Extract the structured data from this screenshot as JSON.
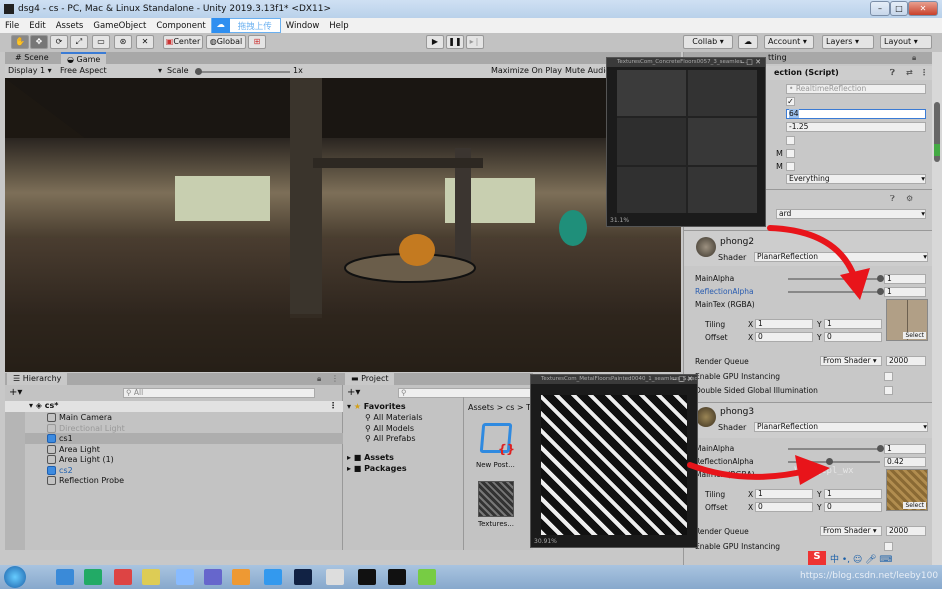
{
  "window": {
    "title": "dsg4 - cs - PC, Mac & Linux Standalone - Unity 2019.3.13f1* <DX11>"
  },
  "menu": [
    "File",
    "Edit",
    "Assets",
    "GameObject",
    "Component",
    "Window",
    "Help"
  ],
  "baidu_overlay": "拖拽上传",
  "toolbar": {
    "center": "Center",
    "global": "Global",
    "collab": "Collab ▾",
    "account": "Account",
    "layers": "Layers",
    "layout": "Layout"
  },
  "tabs": {
    "scene": "Scene",
    "game": "Game"
  },
  "game_toolbar": {
    "display": "Display 1",
    "aspect": "Free Aspect",
    "scale_label": "Scale",
    "scale_value": "1x",
    "maximize": "Maximize On Play",
    "mute": "Mute Audio"
  },
  "inspector": {
    "tab_partial": "tting",
    "component_title": "ection (Script)",
    "script_field": "RealtimeReflection",
    "value_64": "64",
    "value_neg": "-1.25",
    "m1": "M",
    "m2": "M",
    "layer_mask": "Everything",
    "partial_dropdown": "ard",
    "materials": [
      {
        "name": "phong2",
        "shader_label": "Shader",
        "shader": "PlanarReflection",
        "main_alpha_label": "MainAlpha",
        "main_alpha": "1",
        "main_alpha_fraction": 1,
        "refl_alpha_label": "ReflectionAlpha",
        "refl_alpha": "1",
        "refl_alpha_fraction": 1,
        "maintex": "MainTex (RGBA)",
        "tiling": "Tiling",
        "offset": "Offset",
        "tx": "1",
        "ty": "1",
        "ox": "0",
        "oy": "0",
        "select": "Select",
        "render_queue": "Render Queue",
        "rq_mode": "From Shader",
        "rq": "2000",
        "gpu": "Enable GPU Instancing",
        "dsgi": "Double Sided Global Illumination"
      },
      {
        "name": "phong3",
        "shader_label": "Shader",
        "shader": "PlanarReflection",
        "main_alpha_label": "MainAlpha",
        "main_alpha": "1",
        "main_alpha_fraction": 1,
        "refl_alpha_label": "ReflectionAlpha",
        "refl_alpha": "0.42",
        "refl_alpha_fraction": 0.42,
        "maintex": "MainTex (RGBA)",
        "tiling": "Tiling",
        "offset": "Offset",
        "tx": "1",
        "ty": "1",
        "ox": "0",
        "oy": "0",
        "select": "Select",
        "render_queue": "Render Queue",
        "rq_mode": "From Shader",
        "rq": "2000",
        "gpu": "Enable GPU Instancing"
      }
    ],
    "watermark": "VX: qtpl_wx"
  },
  "hierarchy": {
    "title": "Hierarchy",
    "search": "All",
    "scene": "cs*",
    "items": [
      {
        "name": "Main Camera",
        "type": "normal"
      },
      {
        "name": "Directional Light",
        "type": "disabled"
      },
      {
        "name": "cs1",
        "type": "prefab-selected"
      },
      {
        "name": "Area Light",
        "type": "normal"
      },
      {
        "name": "Area Light (1)",
        "type": "normal"
      },
      {
        "name": "cs2",
        "type": "prefab"
      },
      {
        "name": "Reflection Probe",
        "type": "normal"
      }
    ]
  },
  "project": {
    "title": "Project",
    "favorites": "Favorites",
    "fav_items": [
      "All Materials",
      "All Models",
      "All Prefabs"
    ],
    "folders": [
      "Assets",
      "Packages"
    ],
    "breadcrumb": "Assets > cs > T",
    "assets": [
      "New Post...",
      "Textures..."
    ]
  },
  "texture_windows": [
    {
      "title": "TexturesCom_ConcreteFloors0057_3_seamles...",
      "zoom": "31.1%"
    },
    {
      "title": "TexturesCom_MetalFloorsPainted0040_1_seamless_S.psd",
      "zoom": "30.91%"
    }
  ],
  "taskbar": {
    "url_watermark": "https://blog.csdn.net/leeby100"
  },
  "colors": {
    "accent": "#3a7bd5",
    "arrow": "#e8141a",
    "panel": "#c8c8c8"
  }
}
